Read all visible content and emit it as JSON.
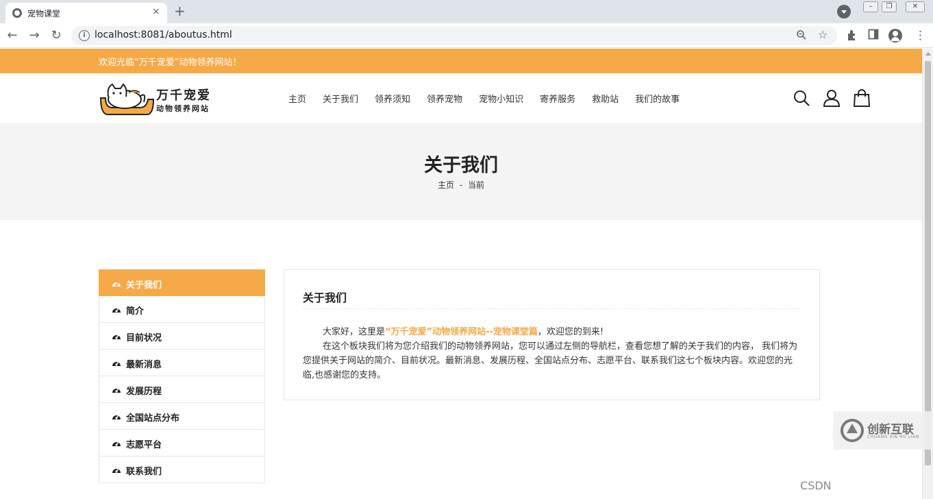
{
  "browser": {
    "tab_title": "宠物课堂",
    "tab_close": "×",
    "new_tab": "+",
    "url": "localhost:8081/aboutus.html"
  },
  "page": {
    "welcome": "欢迎光临“万千宠爱”动物领养网站！",
    "logo": {
      "title": "万千宠爱",
      "subtitle": "动物领养网站"
    },
    "nav": [
      {
        "label": "主页"
      },
      {
        "label": "关于我们"
      },
      {
        "label": "领养须知"
      },
      {
        "label": "领养宠物"
      },
      {
        "label": "宠物小知识"
      },
      {
        "label": "寄养服务"
      },
      {
        "label": "救助站"
      },
      {
        "label": "我们的故事"
      }
    ],
    "header_icons": [
      "search-icon",
      "user-icon",
      "shopping-bag-icon"
    ],
    "banner": {
      "title": "关于我们",
      "breadcrumb_home": "主页",
      "breadcrumb_sep": "-",
      "breadcrumb_current": "当前"
    },
    "sidebar": [
      {
        "label": "关于我们",
        "active": true
      },
      {
        "label": "简介"
      },
      {
        "label": "目前状况"
      },
      {
        "label": "最新消息"
      },
      {
        "label": "发展历程"
      },
      {
        "label": "全国站点分布"
      },
      {
        "label": "志愿平台"
      },
      {
        "label": "联系我们"
      }
    ],
    "content": {
      "title": "关于我们",
      "p1_before": "大家好，这里是",
      "p1_highlight": "“万千宠爱”动物领养网站--宠物课堂篇",
      "p1_after": "，欢迎您的到来!",
      "p2": "在这个板块我们将为您介绍我们的动物领养网站，您可以通过左侧的导航栏，查看您想了解的关于我们的内容， 我们将为您提供关于网站的简介、目前状况。最新消息、发展历程、全国站点分布、志愿平台、联系我们这七个板块内容。欢迎您的光临,也感谢您的支持。"
    },
    "colors": {
      "accent": "#f5a947",
      "banner_bg": "#f4f4f4"
    }
  },
  "watermark": {
    "csdn": "CSDN",
    "brand": "创新互联",
    "brand_sub": "CHUANG XIN HU LIAN"
  }
}
